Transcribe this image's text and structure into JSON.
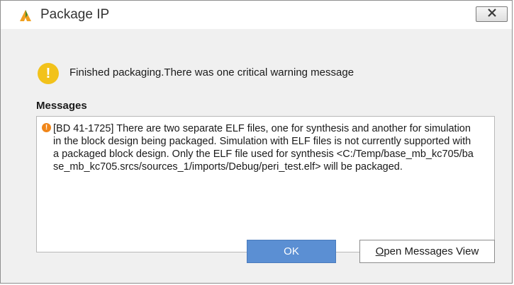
{
  "window": {
    "title": "Package IP"
  },
  "alert": {
    "icon": "warning-icon",
    "message": "Finished packaging.There was one critical warning message"
  },
  "messages": {
    "label": "Messages",
    "items": [
      {
        "icon": "critical-warning-icon",
        "text": "[BD 41-1725] There are two separate ELF files, one for synthesis and another for simulation in the block design being packaged. Simulation with ELF files is not currently supported with a packaged block design. Only the ELF file used for synthesis <C:/Temp/base_mb_kc705/base_mb_kc705.srcs/sources_1/imports/Debug/peri_test.elf> will be packaged."
      }
    ]
  },
  "buttons": {
    "ok": "OK",
    "open_messages_mnemonic": "O",
    "open_messages_rest": "pen Messages View"
  },
  "colors": {
    "ok_button": "#5b8fd3",
    "warning_icon": "#f2c21b",
    "critical_icon": "#f0861a"
  }
}
